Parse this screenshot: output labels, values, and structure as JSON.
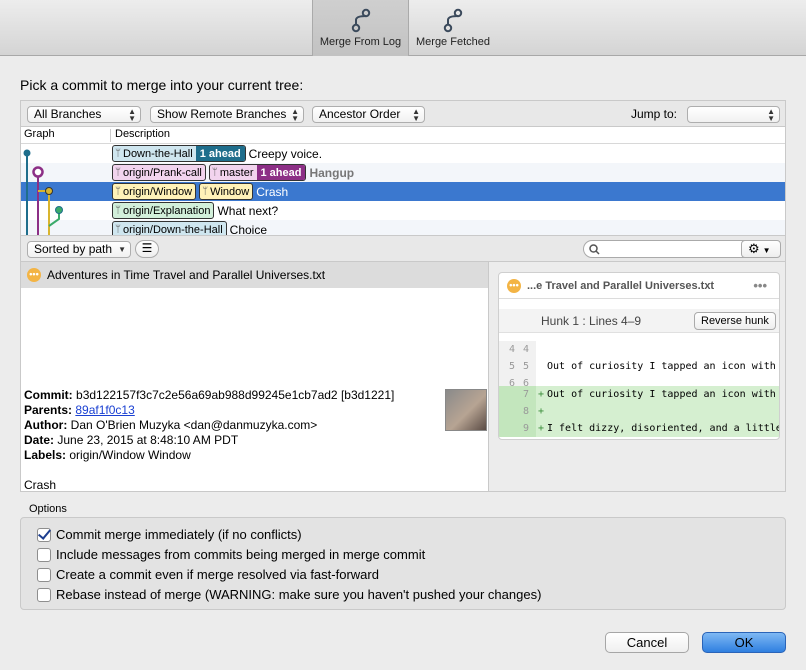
{
  "toolbar": {
    "tabs": [
      {
        "label": "Merge From Log",
        "icon": "branch-merge-icon",
        "active": true
      },
      {
        "label": "Merge Fetched",
        "icon": "branch-merge-icon",
        "active": false
      }
    ]
  },
  "prompt": "Pick a commit to merge into your current tree:",
  "filters": {
    "branches": "All Branches",
    "remote": "Show Remote Branches",
    "order": "Ancestor Order",
    "jump_label": "Jump to:",
    "jump_value": ""
  },
  "columns": {
    "graph": "Graph",
    "description": "Description"
  },
  "commits": [
    {
      "tags": [
        {
          "name": "Down-the-Hall",
          "ahead": "1 ahead"
        }
      ],
      "message": "Creepy voice."
    },
    {
      "tags": [
        {
          "name": "origin/Prank-call"
        },
        {
          "name": "master",
          "ahead": "1 ahead"
        }
      ],
      "message": "Hangup"
    },
    {
      "tags": [
        {
          "name": "origin/Window"
        },
        {
          "name": "Window"
        }
      ],
      "message": "Crash"
    },
    {
      "tags": [
        {
          "name": "origin/Explanation"
        }
      ],
      "message": "What next?"
    },
    {
      "tags": [
        {
          "name": "origin/Down-the-Hall"
        }
      ],
      "message": "Choice"
    }
  ],
  "colors": {
    "blue": "#1f6e8c",
    "purple": "#8c2f86",
    "selection": "#3b78cf",
    "add": "#d5efd0"
  },
  "midbar": {
    "sort": "Sorted by path",
    "search_placeholder": ""
  },
  "files": [
    {
      "name": "Adventures in Time Travel and Parallel Universes.txt",
      "status": "modified"
    }
  ],
  "info": {
    "commit_label": "Commit:",
    "commit": "b3d122157f3c7c2e56a69ab988d99245e1cb7ad2 [b3d1221]",
    "parents_label": "Parents:",
    "parents": "89af1f0c13",
    "author_label": "Author:",
    "author": "Dan O'Brien Muzyka <dan@danmuzyka.com>",
    "date_label": "Date:",
    "date": "June 23, 2015 at 8:48:10 AM PDT",
    "labels_label": "Labels:",
    "labels": "origin/Window Window",
    "message": "Crash"
  },
  "diff": {
    "title": "...e Travel and Parallel Universes.txt",
    "hunk": "Hunk 1 : Lines 4–9",
    "reverse": "Reverse hunk",
    "lines": [
      {
        "old": "4",
        "new": "4",
        "mark": "",
        "text": ""
      },
      {
        "old": "5",
        "new": "5",
        "mark": "",
        "text": "Out of curiosity I tapped an icon with"
      },
      {
        "old": "6",
        "new": "6",
        "mark": "",
        "text": ""
      },
      {
        "old": "",
        "new": "7",
        "mark": "+",
        "text": "Out of curiosity I tapped an icon with"
      },
      {
        "old": "",
        "new": "8",
        "mark": "+",
        "text": ""
      },
      {
        "old": "",
        "new": "9",
        "mark": "+",
        "text": "I felt dizzy, disoriented, and a little"
      }
    ]
  },
  "options": {
    "title": "Options",
    "items": [
      {
        "label": "Commit merge immediately (if no conflicts)",
        "checked": true
      },
      {
        "label": "Include messages from commits being merged in merge commit",
        "checked": false
      },
      {
        "label": "Create a commit even if merge resolved via fast-forward",
        "checked": false
      },
      {
        "label": "Rebase instead of merge (WARNING: make sure you haven't pushed your changes)",
        "checked": false
      }
    ]
  },
  "buttons": {
    "cancel": "Cancel",
    "ok": "OK"
  }
}
